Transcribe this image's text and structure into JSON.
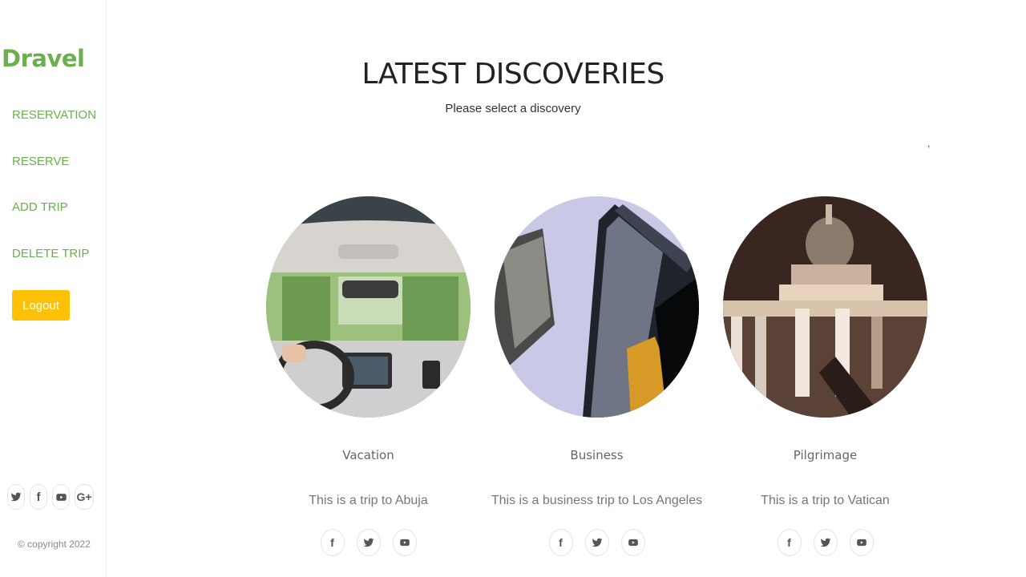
{
  "brand": "Dravel",
  "nav": {
    "reservation": "RESERVATION",
    "reserve": "RESERVE",
    "add_trip": "ADD TRIP",
    "delete_trip": "DELETE TRIP"
  },
  "logout_label": "Logout",
  "sidebar_social": [
    "twitter-icon",
    "facebook-icon",
    "youtube-icon",
    "google-plus-icon"
  ],
  "copyright": "© copyright 2022",
  "header": {
    "title": "LATEST DISCOVERIES",
    "subtitle": "Please select a discovery",
    "stray_mark": ","
  },
  "cards": [
    {
      "title": "Vacation",
      "description": "This is a trip to Abuja",
      "image": "car-interior-road-photo",
      "social": [
        "facebook-icon",
        "twitter-icon",
        "youtube-icon"
      ]
    },
    {
      "title": "Business",
      "description": "This is a business trip to Los Angeles",
      "image": "skyscrapers-photo",
      "social": [
        "facebook-icon",
        "twitter-icon",
        "youtube-icon"
      ]
    },
    {
      "title": "Pilgrimage",
      "description": "This is a trip to Vatican",
      "image": "domed-cathedral-night-photo",
      "social": [
        "facebook-icon",
        "twitter-icon",
        "youtube-icon"
      ]
    }
  ],
  "colors": {
    "brand_green": "#6ab04c",
    "logout_yellow": "#ffc107",
    "title_dark": "#222222"
  }
}
